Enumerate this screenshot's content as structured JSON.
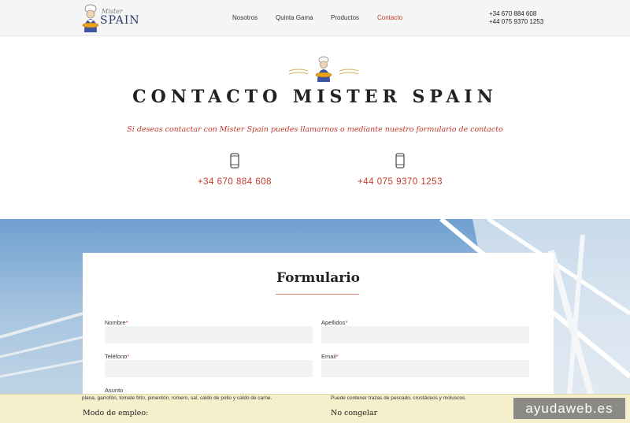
{
  "header": {
    "logo": {
      "script_text": "Mister",
      "word": "SPAIN"
    },
    "nav": [
      {
        "label": "Nosotros"
      },
      {
        "label": "Quinta Gama"
      },
      {
        "label": "Productos"
      },
      {
        "label": "Contacto",
        "active": true
      }
    ],
    "phones": [
      "+34 670 884 608",
      "+44 075 9370 1253"
    ]
  },
  "contact": {
    "title": "CONTACTO MISTER SPAIN",
    "subtitle": "Si deseas contactar con Mister Spain puedes llamarnos o mediante nuestro formulario de contacto",
    "phones": [
      {
        "icon": "mobile-phone-icon",
        "number": "+34 670 884 608"
      },
      {
        "icon": "mobile-phone-icon",
        "number": "+44 075 9370 1253"
      }
    ]
  },
  "form": {
    "title": "Formulario",
    "fields": {
      "nombre": {
        "label": "Nombre",
        "required_mark": "*",
        "value": ""
      },
      "apellidos": {
        "label": "Apellidos",
        "required_mark": "*",
        "value": ""
      },
      "telefono": {
        "label": "Teléfono",
        "required_mark": "*",
        "value": ""
      },
      "email": {
        "label": "Email",
        "required_mark": "*",
        "value": ""
      },
      "asunto": {
        "label": "Asunto"
      }
    }
  },
  "bottom_strip": {
    "ingredients_text": "plana, garrofón, tomate frito, pimentón, romero, sal, caldo de pollo y caldo de carne.",
    "allergen_text": "Puede contener trazas de pescado, crustáceos y moluscos.",
    "modo_empleo": "Modo de empleo:",
    "no_congelar": "No congelar"
  },
  "watermark": "ayudaweb.es",
  "colors": {
    "accent_red": "#c0392b",
    "brand_navy": "#2f3a6b",
    "header_bg": "#f5f5f5",
    "strip_bg": "#f6efcb",
    "input_bg": "#f2f2f2"
  }
}
